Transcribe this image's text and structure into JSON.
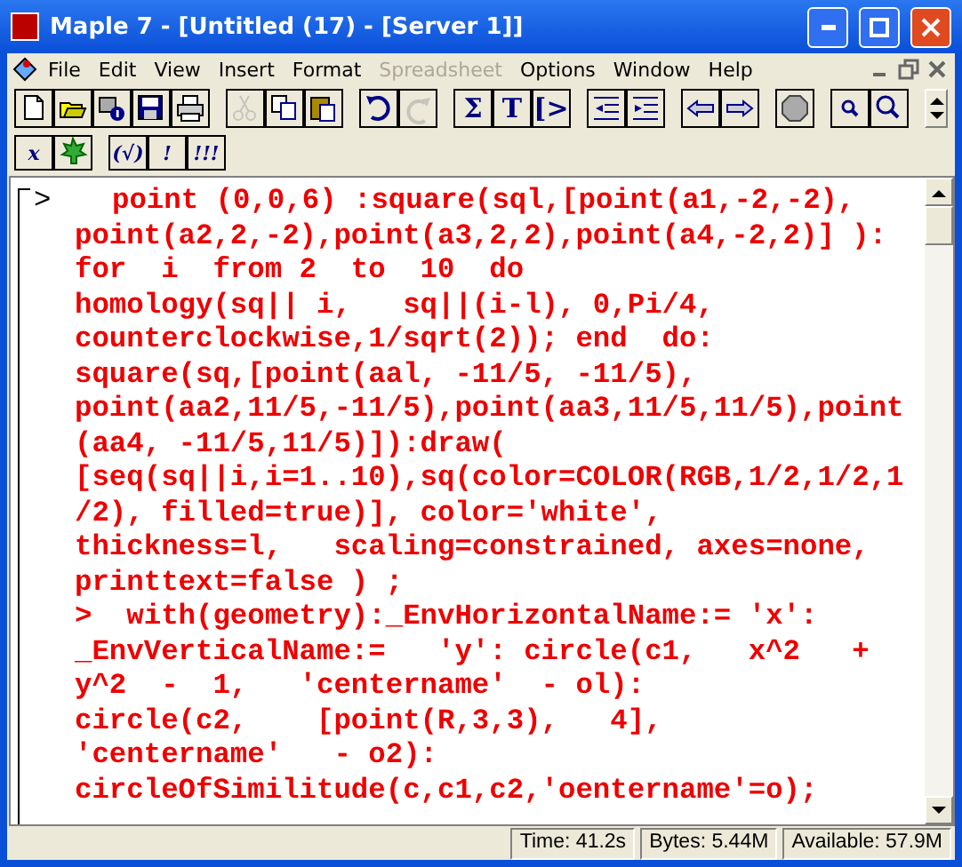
{
  "window": {
    "title": "Maple 7  - [Untitled (17) - [Server 1]]"
  },
  "menu": [
    {
      "label": "File",
      "disabled": false
    },
    {
      "label": "Edit",
      "disabled": false
    },
    {
      "label": "View",
      "disabled": false
    },
    {
      "label": "Insert",
      "disabled": false
    },
    {
      "label": "Format",
      "disabled": false
    },
    {
      "label": "Spreadsheet",
      "disabled": true
    },
    {
      "label": "Options",
      "disabled": false
    },
    {
      "label": "Window",
      "disabled": false
    },
    {
      "label": "Help",
      "disabled": false
    }
  ],
  "toolbar": [
    [
      {
        "kind": "new",
        "disabled": false
      },
      {
        "kind": "open",
        "disabled": false
      },
      {
        "kind": "info",
        "disabled": false
      },
      {
        "kind": "save",
        "disabled": false
      },
      {
        "kind": "print",
        "disabled": false
      }
    ],
    [
      {
        "kind": "cut",
        "disabled": true
      },
      {
        "kind": "copy",
        "disabled": false
      },
      {
        "kind": "paste",
        "disabled": false
      }
    ],
    [
      {
        "kind": "undo",
        "disabled": false
      },
      {
        "kind": "redo",
        "disabled": true
      }
    ],
    [
      {
        "kind": "glyph",
        "label": "Σ",
        "disabled": false
      },
      {
        "kind": "glyph",
        "label": "T",
        "disabled": false
      },
      {
        "kind": "glyph",
        "label": "[>",
        "disabled": false
      }
    ],
    [
      {
        "kind": "outdent",
        "disabled": false
      },
      {
        "kind": "indent",
        "disabled": false
      }
    ],
    [
      {
        "kind": "back",
        "disabled": false
      },
      {
        "kind": "forward",
        "disabled": false
      }
    ],
    [
      {
        "kind": "stop",
        "disabled": false
      }
    ],
    [
      {
        "kind": "zoom-small",
        "disabled": false
      },
      {
        "kind": "zoom-large",
        "disabled": false
      }
    ]
  ],
  "toolbar2": [
    [
      {
        "kind": "glyph",
        "label": "x",
        "disabled": false
      },
      {
        "kind": "leaf",
        "disabled": false
      }
    ],
    [
      {
        "kind": "glyph",
        "label": "(√)",
        "disabled": false
      },
      {
        "kind": "glyph",
        "label": "!",
        "disabled": false
      },
      {
        "kind": "glyph",
        "label": "!!!",
        "disabled": false
      }
    ]
  ],
  "worksheet": {
    "prompt": ">",
    "lines": [
      "point (0,0,6) :square(sql,[point(a1,-2,-2),",
      "point(a2,2,-2),point(a3,2,2),point(a4,-2,2)] ):",
      "for  i  from 2  to  10  do",
      "homology(sq|| i,   sq||(i-l), 0,Pi/4,",
      "counterclockwise,1/sqrt(2)); end  do:",
      "square(sq,[point(aal, -11/5, -11/5),",
      "point(aa2,11/5,-11/5),point(aa3,11/5,11/5),point",
      "(aa4, -11/5,11/5)]):draw(",
      "[seq(sq||i,i=1..10),sq(color=COLOR(RGB,1/2,1/2,1",
      "/2), filled=true)], color='white',",
      "thickness=l,   scaling=constrained, axes=none,",
      "printtext=false ) ;",
      ">  with(geometry):_EnvHorizontalName:= 'x':",
      "_EnvVerticalName:=   'y': circle(c1,   x^2   +",
      "y^2  -  1,   'centername'  - ol):",
      "circle(c2,    [point(R,3,3),   4],",
      "'centername'   - o2):",
      "circleOfSimilitude(c,c1,c2,'oentername'=o);"
    ]
  },
  "status_bar": [
    "Time:  41.2s",
    "Bytes: 5.44M",
    "Available: 57.9M"
  ]
}
